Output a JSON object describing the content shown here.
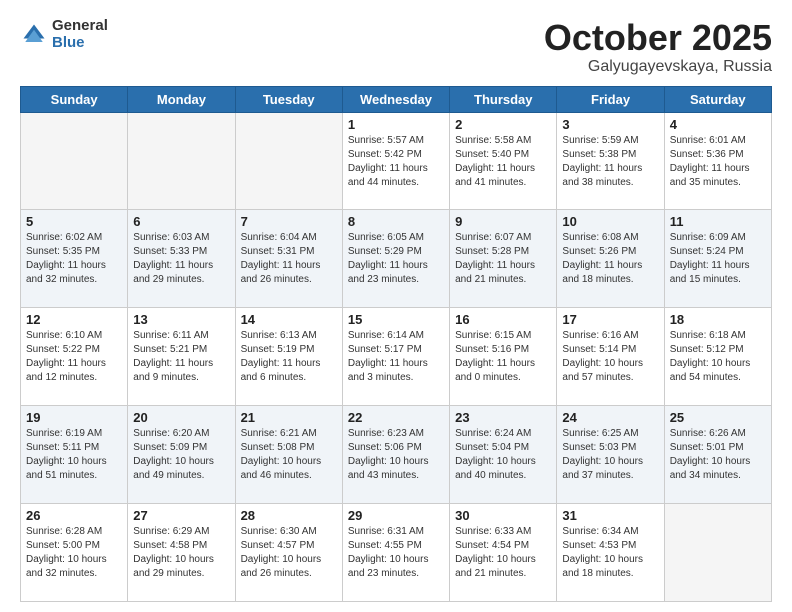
{
  "logo": {
    "general": "General",
    "blue": "Blue"
  },
  "title": "October 2025",
  "location": "Galyugayevskaya, Russia",
  "days": [
    "Sunday",
    "Monday",
    "Tuesday",
    "Wednesday",
    "Thursday",
    "Friday",
    "Saturday"
  ],
  "weeks": [
    [
      {
        "day": "",
        "content": ""
      },
      {
        "day": "",
        "content": ""
      },
      {
        "day": "",
        "content": ""
      },
      {
        "day": "1",
        "content": "Sunrise: 5:57 AM\nSunset: 5:42 PM\nDaylight: 11 hours\nand 44 minutes."
      },
      {
        "day": "2",
        "content": "Sunrise: 5:58 AM\nSunset: 5:40 PM\nDaylight: 11 hours\nand 41 minutes."
      },
      {
        "day": "3",
        "content": "Sunrise: 5:59 AM\nSunset: 5:38 PM\nDaylight: 11 hours\nand 38 minutes."
      },
      {
        "day": "4",
        "content": "Sunrise: 6:01 AM\nSunset: 5:36 PM\nDaylight: 11 hours\nand 35 minutes."
      }
    ],
    [
      {
        "day": "5",
        "content": "Sunrise: 6:02 AM\nSunset: 5:35 PM\nDaylight: 11 hours\nand 32 minutes."
      },
      {
        "day": "6",
        "content": "Sunrise: 6:03 AM\nSunset: 5:33 PM\nDaylight: 11 hours\nand 29 minutes."
      },
      {
        "day": "7",
        "content": "Sunrise: 6:04 AM\nSunset: 5:31 PM\nDaylight: 11 hours\nand 26 minutes."
      },
      {
        "day": "8",
        "content": "Sunrise: 6:05 AM\nSunset: 5:29 PM\nDaylight: 11 hours\nand 23 minutes."
      },
      {
        "day": "9",
        "content": "Sunrise: 6:07 AM\nSunset: 5:28 PM\nDaylight: 11 hours\nand 21 minutes."
      },
      {
        "day": "10",
        "content": "Sunrise: 6:08 AM\nSunset: 5:26 PM\nDaylight: 11 hours\nand 18 minutes."
      },
      {
        "day": "11",
        "content": "Sunrise: 6:09 AM\nSunset: 5:24 PM\nDaylight: 11 hours\nand 15 minutes."
      }
    ],
    [
      {
        "day": "12",
        "content": "Sunrise: 6:10 AM\nSunset: 5:22 PM\nDaylight: 11 hours\nand 12 minutes."
      },
      {
        "day": "13",
        "content": "Sunrise: 6:11 AM\nSunset: 5:21 PM\nDaylight: 11 hours\nand 9 minutes."
      },
      {
        "day": "14",
        "content": "Sunrise: 6:13 AM\nSunset: 5:19 PM\nDaylight: 11 hours\nand 6 minutes."
      },
      {
        "day": "15",
        "content": "Sunrise: 6:14 AM\nSunset: 5:17 PM\nDaylight: 11 hours\nand 3 minutes."
      },
      {
        "day": "16",
        "content": "Sunrise: 6:15 AM\nSunset: 5:16 PM\nDaylight: 11 hours\nand 0 minutes."
      },
      {
        "day": "17",
        "content": "Sunrise: 6:16 AM\nSunset: 5:14 PM\nDaylight: 10 hours\nand 57 minutes."
      },
      {
        "day": "18",
        "content": "Sunrise: 6:18 AM\nSunset: 5:12 PM\nDaylight: 10 hours\nand 54 minutes."
      }
    ],
    [
      {
        "day": "19",
        "content": "Sunrise: 6:19 AM\nSunset: 5:11 PM\nDaylight: 10 hours\nand 51 minutes."
      },
      {
        "day": "20",
        "content": "Sunrise: 6:20 AM\nSunset: 5:09 PM\nDaylight: 10 hours\nand 49 minutes."
      },
      {
        "day": "21",
        "content": "Sunrise: 6:21 AM\nSunset: 5:08 PM\nDaylight: 10 hours\nand 46 minutes."
      },
      {
        "day": "22",
        "content": "Sunrise: 6:23 AM\nSunset: 5:06 PM\nDaylight: 10 hours\nand 43 minutes."
      },
      {
        "day": "23",
        "content": "Sunrise: 6:24 AM\nSunset: 5:04 PM\nDaylight: 10 hours\nand 40 minutes."
      },
      {
        "day": "24",
        "content": "Sunrise: 6:25 AM\nSunset: 5:03 PM\nDaylight: 10 hours\nand 37 minutes."
      },
      {
        "day": "25",
        "content": "Sunrise: 6:26 AM\nSunset: 5:01 PM\nDaylight: 10 hours\nand 34 minutes."
      }
    ],
    [
      {
        "day": "26",
        "content": "Sunrise: 6:28 AM\nSunset: 5:00 PM\nDaylight: 10 hours\nand 32 minutes."
      },
      {
        "day": "27",
        "content": "Sunrise: 6:29 AM\nSunset: 4:58 PM\nDaylight: 10 hours\nand 29 minutes."
      },
      {
        "day": "28",
        "content": "Sunrise: 6:30 AM\nSunset: 4:57 PM\nDaylight: 10 hours\nand 26 minutes."
      },
      {
        "day": "29",
        "content": "Sunrise: 6:31 AM\nSunset: 4:55 PM\nDaylight: 10 hours\nand 23 minutes."
      },
      {
        "day": "30",
        "content": "Sunrise: 6:33 AM\nSunset: 4:54 PM\nDaylight: 10 hours\nand 21 minutes."
      },
      {
        "day": "31",
        "content": "Sunrise: 6:34 AM\nSunset: 4:53 PM\nDaylight: 10 hours\nand 18 minutes."
      },
      {
        "day": "",
        "content": ""
      }
    ]
  ]
}
